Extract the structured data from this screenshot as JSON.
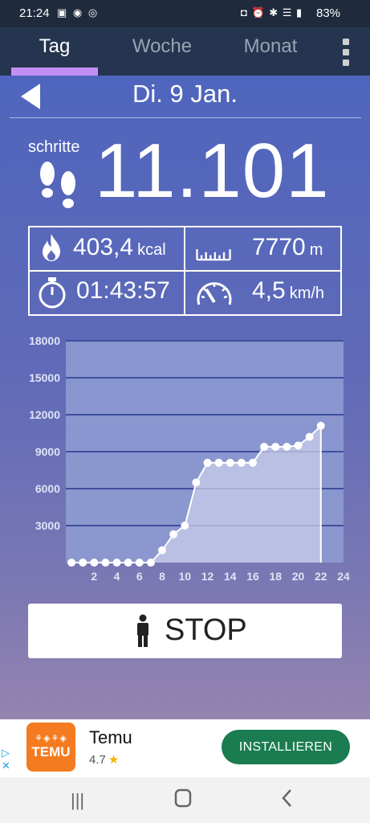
{
  "status_bar": {
    "time": "21:24",
    "battery": "83%"
  },
  "tabs": [
    {
      "label": "Tag",
      "active": true
    },
    {
      "label": "Woche",
      "active": false
    },
    {
      "label": "Monat",
      "active": false
    }
  ],
  "date": "Di. 9 Jan.",
  "steps": {
    "label": "schritte",
    "value": "11.101"
  },
  "stats": {
    "calories": {
      "value": "403,4",
      "unit": "kcal",
      "icon": "flame-icon"
    },
    "distance": {
      "value": "7770",
      "unit": "m",
      "icon": "ruler-icon"
    },
    "duration": {
      "value": "01:43:57",
      "unit": "",
      "icon": "stopwatch-icon"
    },
    "speed": {
      "value": "4,5",
      "unit": "km/h",
      "icon": "speedometer-icon"
    }
  },
  "chart_data": {
    "type": "area",
    "x": [
      0,
      1,
      2,
      3,
      4,
      5,
      6,
      7,
      8,
      9,
      10,
      11,
      12,
      13,
      14,
      15,
      16,
      17,
      18,
      19,
      20,
      21,
      22
    ],
    "values": [
      0,
      0,
      0,
      0,
      0,
      0,
      0,
      0,
      1000,
      2300,
      3000,
      6500,
      8100,
      8100,
      8100,
      8100,
      8100,
      9400,
      9400,
      9400,
      9500,
      10200,
      11101
    ],
    "y_ticks": [
      "18000",
      "15000",
      "12000",
      "9000",
      "6000",
      "3000"
    ],
    "x_ticks": [
      "2",
      "4",
      "6",
      "8",
      "10",
      "12",
      "14",
      "16",
      "18",
      "20",
      "22",
      "24"
    ],
    "ylim": [
      0,
      18000
    ],
    "xlim": [
      -0.5,
      24
    ],
    "grid": true,
    "colors": {
      "line": "#ffffff",
      "fill": "#c9cdea",
      "plot_bg": "#8f9ed3",
      "grid": "#3e4f9e"
    }
  },
  "stop_button": {
    "label": "STOP",
    "icon": "person-icon"
  },
  "ad": {
    "app_name": "Temu",
    "logo_text": "TEMU",
    "rating": "4.7",
    "install_label": "INSTALLIEREN"
  }
}
